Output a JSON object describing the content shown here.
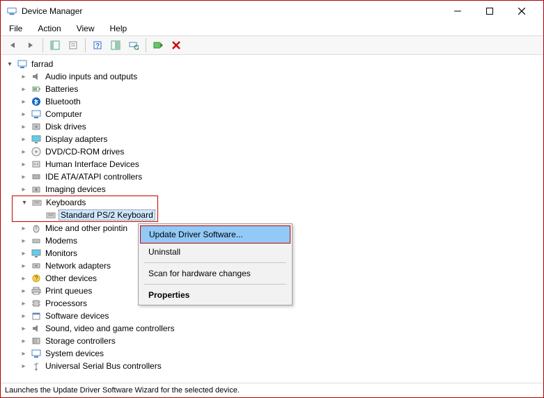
{
  "window": {
    "title": "Device Manager"
  },
  "menu": {
    "items": [
      "File",
      "Action",
      "View",
      "Help"
    ]
  },
  "tree": {
    "root": "farrad",
    "nodes": [
      "Audio inputs and outputs",
      "Batteries",
      "Bluetooth",
      "Computer",
      "Disk drives",
      "Display adapters",
      "DVD/CD-ROM drives",
      "Human Interface Devices",
      "IDE ATA/ATAPI controllers",
      "Imaging devices",
      "Keyboards",
      "Mice and other pointin",
      "Modems",
      "Monitors",
      "Network adapters",
      "Other devices",
      "Print queues",
      "Processors",
      "Software devices",
      "Sound, video and game controllers",
      "Storage controllers",
      "System devices",
      "Universal Serial Bus controllers"
    ],
    "keyboard_child": "Standard PS/2 Keyboard"
  },
  "context_menu": {
    "update": "Update Driver Software...",
    "uninstall": "Uninstall",
    "scan": "Scan for hardware changes",
    "properties": "Properties"
  },
  "status": "Launches the Update Driver Software Wizard for the selected device."
}
